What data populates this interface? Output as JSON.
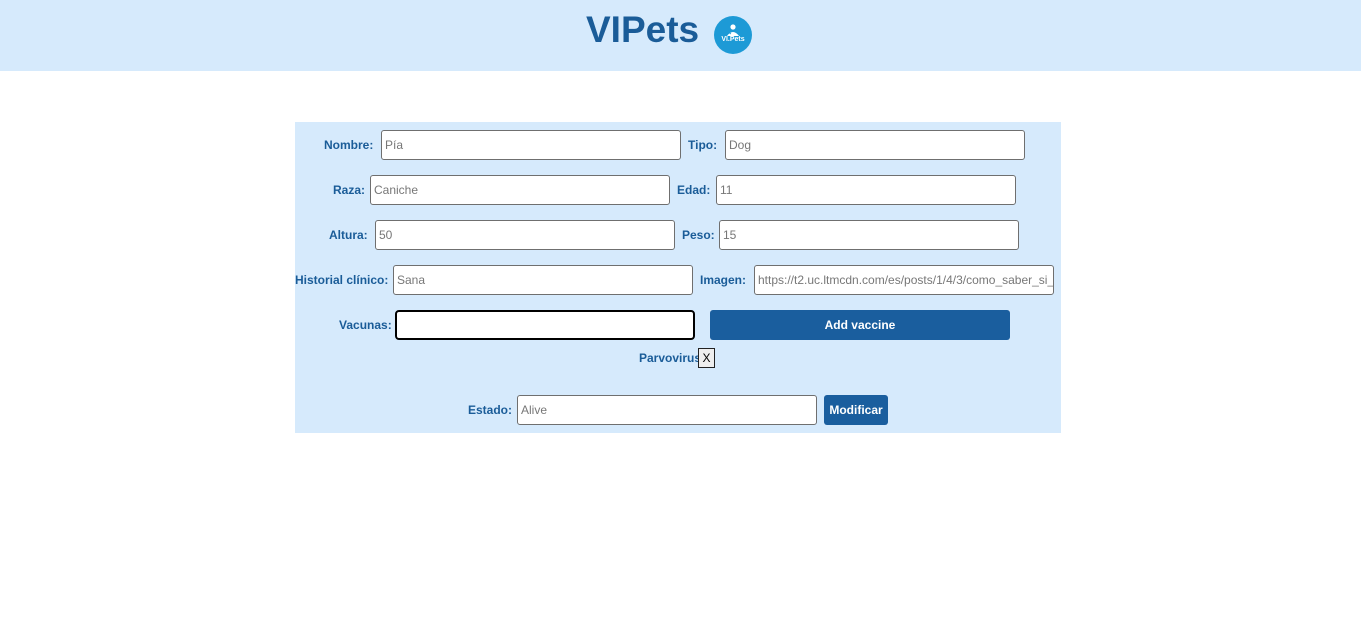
{
  "header": {
    "title": "VIPets",
    "logo_text": "VI.Pets"
  },
  "form": {
    "nombre": {
      "label": "Nombre:",
      "value": "Pía"
    },
    "tipo": {
      "label": "Tipo:",
      "value": "Dog"
    },
    "raza": {
      "label": "Raza:",
      "value": "Caniche"
    },
    "edad": {
      "label": "Edad:",
      "value": "11"
    },
    "altura": {
      "label": "Altura:",
      "value": "50"
    },
    "peso": {
      "label": "Peso:",
      "value": "15"
    },
    "historial": {
      "label": "Historial clínico:",
      "value": "Sana"
    },
    "imagen": {
      "label": "Imagen:",
      "value": "https://t2.uc.ltmcdn.com/es/posts/1/4/3/como_saber_si_"
    },
    "vacunas": {
      "label": "Vacunas:",
      "value": ""
    },
    "add_vaccine_label": "Add vaccine",
    "vaccines": [
      {
        "name": "Parvovirus",
        "remove_label": "X"
      }
    ],
    "estado": {
      "label": "Estado:",
      "value": "Alive"
    },
    "submit_label": "Modificar"
  },
  "colors": {
    "header_bg": "#d6eafc",
    "panel_bg": "#d6eafc",
    "brand": "#1a5c98",
    "button": "#1a5e9e"
  }
}
